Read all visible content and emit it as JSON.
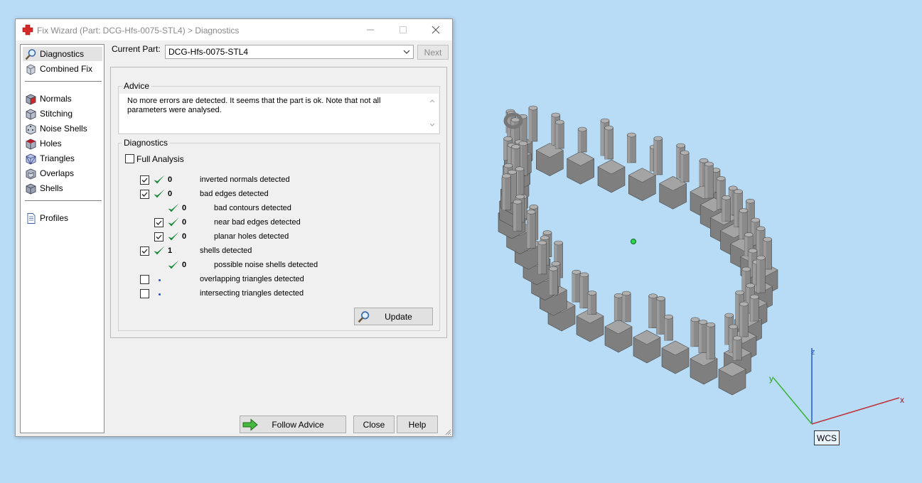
{
  "window": {
    "title": "Fix Wizard (Part: DCG-Hfs-0075-STL4) > Diagnostics",
    "icon": "red-cross-icon",
    "controls": [
      "minimize-icon",
      "maximize-icon",
      "close-icon"
    ]
  },
  "sidebar": {
    "items": [
      {
        "label": "Diagnostics",
        "icon": "magnifier-icon",
        "selected": true
      },
      {
        "label": "Combined Fix",
        "icon": "stacked-cubes-icon"
      },
      {
        "label": "Normals",
        "icon": "cube-red-face-icon"
      },
      {
        "label": "Stitching",
        "icon": "cube-stitch-icon"
      },
      {
        "label": "Noise Shells",
        "icon": "dice-icon"
      },
      {
        "label": "Holes",
        "icon": "cube-hole-icon"
      },
      {
        "label": "Triangles",
        "icon": "cube-triangles-icon"
      },
      {
        "label": "Overlaps",
        "icon": "cube-overlap-icon"
      },
      {
        "label": "Shells",
        "icon": "cube-shells-icon"
      },
      {
        "label": "Profiles",
        "icon": "document-icon"
      }
    ]
  },
  "part": {
    "label": "Current Part:",
    "value": "DCG-Hfs-0075-STL4",
    "next_label": "Next"
  },
  "advice": {
    "title": "Advice",
    "text": "No more errors are detected. It seems that the part is ok. Note that not all parameters were analysed."
  },
  "diagnostics": {
    "title": "Diagnostics",
    "full_analysis_label": "Full Analysis",
    "rows": [
      {
        "checkbox": true,
        "checked": true,
        "ok": true,
        "value": "0",
        "label": "inverted normals detected",
        "indent": 0
      },
      {
        "checkbox": true,
        "checked": true,
        "ok": true,
        "value": "0",
        "label": "bad edges detected",
        "indent": 0
      },
      {
        "checkbox": false,
        "checked": false,
        "ok": true,
        "value": "0",
        "label": "bad contours detected",
        "indent": 1
      },
      {
        "checkbox": true,
        "checked": true,
        "ok": true,
        "value": "0",
        "label": "near bad edges detected",
        "indent": 1
      },
      {
        "checkbox": true,
        "checked": true,
        "ok": true,
        "value": "0",
        "label": "planar holes detected",
        "indent": 1
      },
      {
        "checkbox": true,
        "checked": true,
        "ok": true,
        "value": "1",
        "label": "shells detected",
        "indent": 0
      },
      {
        "checkbox": false,
        "checked": false,
        "ok": true,
        "value": "0",
        "label": "possible noise shells detected",
        "indent": 1
      },
      {
        "checkbox": true,
        "checked": false,
        "ok": false,
        "value": "",
        "label": "overlapping triangles detected",
        "indent": 0
      },
      {
        "checkbox": true,
        "checked": false,
        "ok": false,
        "value": "",
        "label": "intersecting triangles detected",
        "indent": 0
      }
    ],
    "update_label": "Update"
  },
  "footer": {
    "follow_label": "Follow Advice",
    "close_label": "Close",
    "help_label": "Help"
  },
  "viewport": {
    "axes": {
      "x": "x",
      "y": "y",
      "z": "z"
    },
    "wcs_label": "WCS",
    "colors": {
      "background": "#b9dcf6",
      "part": "#7d7d7d",
      "x_axis": "#c0313a",
      "y_axis": "#3cb53c",
      "z_axis": "#2d5fd0"
    }
  }
}
